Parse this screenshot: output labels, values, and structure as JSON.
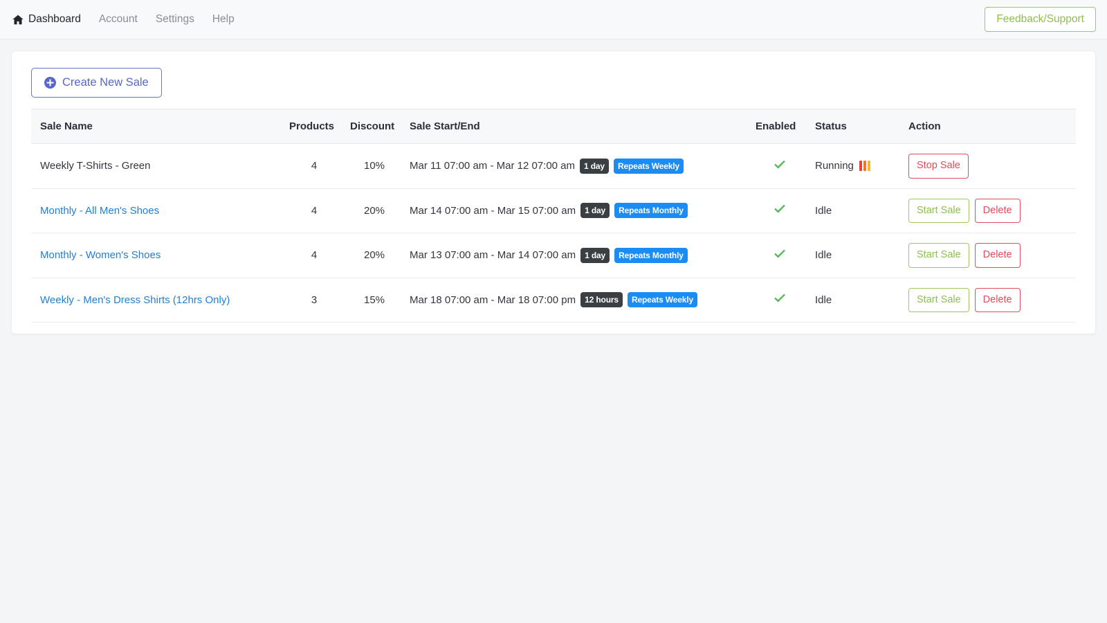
{
  "navbar": {
    "brand_label": "Dashboard",
    "brand_icon": "home-icon",
    "items": [
      {
        "label": "Account"
      },
      {
        "label": "Settings"
      },
      {
        "label": "Help"
      }
    ],
    "feedback_label": "Feedback/Support",
    "feedback_color": "#8dbf4d"
  },
  "toolbar": {
    "create_label": "Create New Sale",
    "create_icon": "plus-circle-icon",
    "create_color": "#5867c9"
  },
  "table": {
    "columns": [
      {
        "key": "name",
        "label": "Sale Name"
      },
      {
        "key": "products",
        "label": "Products"
      },
      {
        "key": "discount",
        "label": "Discount"
      },
      {
        "key": "dates",
        "label": "Sale Start/End"
      },
      {
        "key": "enabled",
        "label": "Enabled"
      },
      {
        "key": "status",
        "label": "Status"
      },
      {
        "key": "action",
        "label": "Action"
      }
    ],
    "rows": [
      {
        "name": "Weekly T-Shirts - Green",
        "name_is_link": false,
        "products": "4",
        "discount": "10%",
        "dates": "Mar 11 07:00 am - Mar 12 07:00 am",
        "duration_badge": "1 day",
        "repeat_badge": "Repeats Weekly",
        "enabled": true,
        "enabled_icon": "check-icon",
        "status": "Running",
        "status_running": true,
        "actions": [
          {
            "label": "Stop Sale",
            "style": "danger",
            "name": "stop-sale-button"
          }
        ]
      },
      {
        "name": "Monthly - All Men's Shoes",
        "name_is_link": true,
        "products": "4",
        "discount": "20%",
        "dates": "Mar 14 07:00 am - Mar 15 07:00 am",
        "duration_badge": "1 day",
        "repeat_badge": "Repeats Monthly",
        "enabled": true,
        "enabled_icon": "check-icon",
        "status": "Idle",
        "status_running": false,
        "actions": [
          {
            "label": "Start Sale",
            "style": "success",
            "name": "start-sale-button"
          },
          {
            "label": "Delete",
            "style": "danger",
            "name": "delete-button"
          }
        ]
      },
      {
        "name": "Monthly - Women's Shoes",
        "name_is_link": true,
        "products": "4",
        "discount": "20%",
        "dates": "Mar 13 07:00 am - Mar 14 07:00 am",
        "duration_badge": "1 day",
        "repeat_badge": "Repeats Monthly",
        "enabled": true,
        "enabled_icon": "check-icon",
        "status": "Idle",
        "status_running": false,
        "actions": [
          {
            "label": "Start Sale",
            "style": "success",
            "name": "start-sale-button"
          },
          {
            "label": "Delete",
            "style": "danger",
            "name": "delete-button"
          }
        ]
      },
      {
        "name": "Weekly - Men's Dress Shirts (12hrs Only)",
        "name_is_link": true,
        "products": "3",
        "discount": "15%",
        "dates": "Mar 18 07:00 am - Mar 18 07:00 pm",
        "duration_badge": "12 hours",
        "repeat_badge": "Repeats Weekly",
        "enabled": true,
        "enabled_icon": "check-icon",
        "status": "Idle",
        "status_running": false,
        "actions": [
          {
            "label": "Start Sale",
            "style": "success",
            "name": "start-sale-button"
          },
          {
            "label": "Delete",
            "style": "danger",
            "name": "delete-button"
          }
        ]
      }
    ]
  },
  "colors": {
    "link": "#1f7fd4",
    "badge_dark": "#3a3f44",
    "badge_blue": "#1b8cf3",
    "danger": "#e34a5c",
    "success": "#8dbf4d",
    "primary": "#5867c9",
    "check": "#5cb85c",
    "running_bars": [
      "#e8413a",
      "#f4752a",
      "#fcb62c"
    ]
  }
}
